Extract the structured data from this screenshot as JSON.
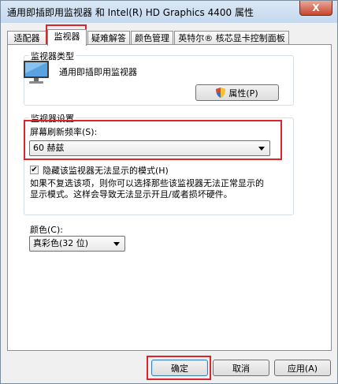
{
  "window": {
    "title": "通用即插即用监视器 和 Intel(R) HD Graphics 4400 属性",
    "close_glyph": "X"
  },
  "tabs": [
    {
      "label": "适配器"
    },
    {
      "label": "监视器"
    },
    {
      "label": "疑难解答"
    },
    {
      "label": "颜色管理"
    },
    {
      "label": "英特尔® 核芯显卡控制面板"
    }
  ],
  "active_tab": "监视器",
  "monitor_type": {
    "group_title": "监视器类型",
    "name": "通用即插即用监视器",
    "properties_button": "属性(P)",
    "icon": "monitor-icon"
  },
  "monitor_settings": {
    "group_title": "监视器设置",
    "refresh_label": "屏幕刷新频率(S):",
    "refresh_value": "60 赫兹",
    "hide_modes_label": "隐藏该监视器无法显示的模式(H)",
    "hide_modes_checked": true,
    "check_glyph": "✔",
    "description_line1": "如果不复选该项，则你可以选择那些该监视器无法正常显示的",
    "description_line2": "显示模式。这样会导致无法显示开且/或者损坏硬件。"
  },
  "color": {
    "label": "颜色(C):",
    "value": "真彩色(32 位)"
  },
  "footer": {
    "ok": "确定",
    "cancel": "取消",
    "apply": "应用(A)"
  },
  "colors": {
    "highlight_red": "#d9252b",
    "title_bar": "#c4d8ee"
  }
}
